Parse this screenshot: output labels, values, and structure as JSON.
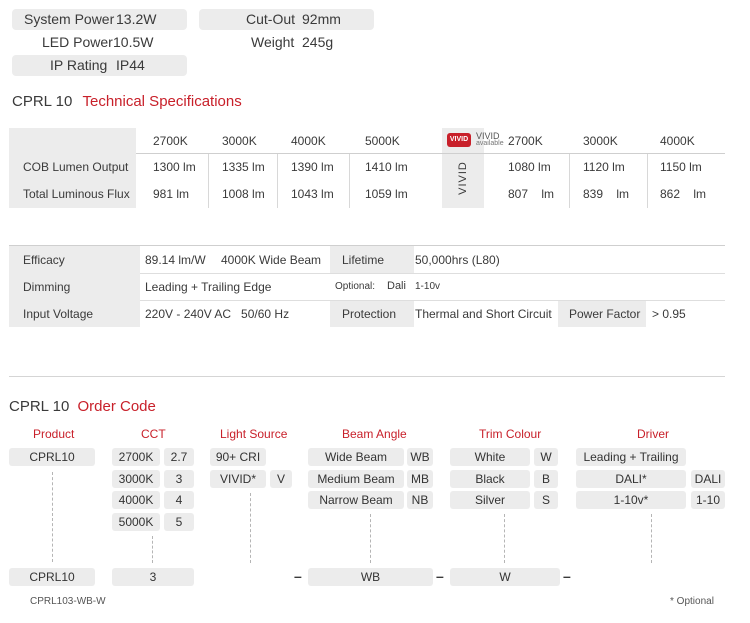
{
  "specs_top": {
    "system_power_label": "System Power",
    "system_power_value": "13.2W",
    "led_power_label": "LED Power",
    "led_power_value": "10.5W",
    "ip_rating_label": "IP Rating",
    "ip_rating_value": "IP44",
    "cutout_label": "Cut-Out",
    "cutout_value": "92mm",
    "weight_label": "Weight",
    "weight_value": "245g"
  },
  "tech": {
    "model": "CPRL 10",
    "title": "Technical Specifications",
    "cct_headers": [
      "2700K",
      "3000K",
      "4000K",
      "5000K"
    ],
    "vivid_logo": "VIVID",
    "vivid_note_1": "VIVID",
    "vivid_note_2": "available",
    "vivid_side": "VIVID",
    "vivid_headers": [
      "2700K",
      "3000K",
      "4000K"
    ],
    "rows": [
      {
        "label": "COB Lumen Output",
        "values": [
          "1300 lm",
          "1335 lm",
          "1390 lm",
          "1410 lm"
        ],
        "vivid": [
          "1080 lm",
          "1120 lm",
          "1150 lm"
        ]
      },
      {
        "label": "Total Luminous Flux",
        "values": [
          "981 lm",
          "1008 lm",
          "1043 lm",
          "1059 lm"
        ],
        "vivid": [
          "807 lm",
          "839 lm",
          "862 lm"
        ]
      }
    ]
  },
  "props": {
    "efficacy_label": "Efficacy",
    "efficacy_value": "89.14 lm/W",
    "efficacy_note": "4000K Wide Beam",
    "lifetime_label": "Lifetime",
    "lifetime_value": "50,000hrs (L80)",
    "dimming_label": "Dimming",
    "dimming_value": "Leading + Trailing Edge",
    "optional_label": "Optional:",
    "optional_dali": "Dali",
    "optional_110": "1-10v",
    "input_label": "Input Voltage",
    "input_value": "220V - 240V AC   50/60 Hz",
    "protection_label": "Protection",
    "protection_value": "Thermal and Short Circuit",
    "pf_label": "Power Factor",
    "pf_value": "> 0.95"
  },
  "order": {
    "model": "CPRL 10",
    "title": "Order Code",
    "headers": {
      "product": "Product",
      "cct": "CCT",
      "light": "Light Source",
      "beam": "Beam Angle",
      "trim": "Trim Colour",
      "driver": "Driver"
    },
    "product": "CPRL10",
    "cct": [
      {
        "name": "2700K",
        "code": "2.7"
      },
      {
        "name": "3000K",
        "code": "3"
      },
      {
        "name": "4000K",
        "code": "4"
      },
      {
        "name": "5000K",
        "code": "5"
      }
    ],
    "light": [
      {
        "name": "90+ CRI",
        "code": ""
      },
      {
        "name": "VIVID*",
        "code": "V"
      }
    ],
    "beam": [
      {
        "name": "Wide Beam",
        "code": "WB"
      },
      {
        "name": "Medium Beam",
        "code": "MB"
      },
      {
        "name": "Narrow Beam",
        "code": "NB"
      }
    ],
    "trim": [
      {
        "name": "White",
        "code": "W"
      },
      {
        "name": "Black",
        "code": "B"
      },
      {
        "name": "Silver",
        "code": "S"
      }
    ],
    "driver": [
      {
        "name": "Leading + Trailing",
        "code": ""
      },
      {
        "name": "DALI*",
        "code": "DALI"
      },
      {
        "name": "1-10v*",
        "code": "1-10"
      }
    ],
    "result": {
      "product": "CPRL10",
      "cct": "3",
      "light": "",
      "beam": "WB",
      "trim": "W",
      "driver": ""
    },
    "dash": "–",
    "example": "CPRL103-WB-W",
    "footnote": "* Optional"
  }
}
